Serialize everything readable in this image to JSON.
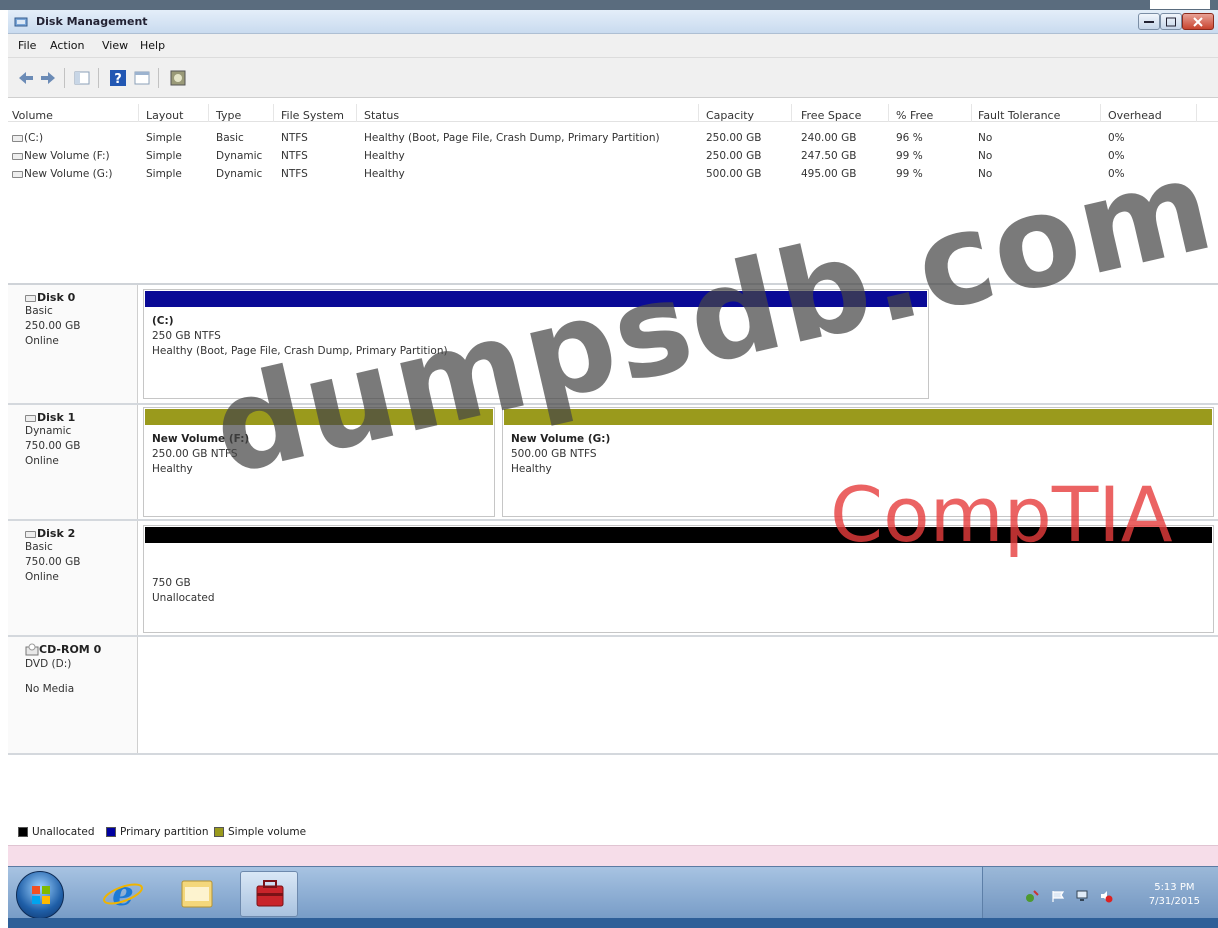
{
  "window": {
    "title": "Disk Management"
  },
  "menu": [
    "File",
    "Action",
    "View",
    "Help"
  ],
  "toolbar": {
    "icons": [
      "back-arrow-icon",
      "forward-arrow-icon",
      "console-tree-icon",
      "help-icon",
      "properties-icon",
      "disk-management-icon"
    ]
  },
  "volume_list": {
    "columns": [
      "Volume",
      "Layout",
      "Type",
      "File System",
      "Status",
      "Capacity",
      "Free Space",
      "% Free",
      "Fault Tolerance",
      "Overhead"
    ],
    "rows": [
      [
        "(C:)",
        "Simple",
        "Basic",
        "NTFS",
        "Healthy (Boot, Page File, Crash Dump, Primary Partition)",
        "250.00 GB",
        "240.00 GB",
        "96 %",
        "No",
        "0%"
      ],
      [
        "New Volume (F:)",
        "Simple",
        "Dynamic",
        "NTFS",
        "Healthy",
        "250.00 GB",
        "247.50 GB",
        "99 %",
        "No",
        "0%"
      ],
      [
        "New Volume (G:)",
        "Simple",
        "Dynamic",
        "NTFS",
        "Healthy",
        "500.00 GB",
        "495.00 GB",
        "99 %",
        "No",
        "0%"
      ]
    ]
  },
  "disks": [
    {
      "name": "Disk 0",
      "type": "Basic",
      "size": "250.00 GB",
      "state": "Online",
      "partitions": [
        {
          "name": "(C:)",
          "line1": "250 GB NTFS",
          "line2": "Healthy (Boot, Page File, Crash Dump, Primary Partition)",
          "kind": "Primary partition"
        }
      ]
    },
    {
      "name": "Disk 1",
      "type": "Dynamic",
      "size": "750.00 GB",
      "state": "Online",
      "partitions": [
        {
          "name": "New Volume (F:)",
          "line1": "250.00 GB NTFS",
          "line2": "Healthy",
          "kind": "Simple volume"
        },
        {
          "name": "New Volume (G:)",
          "line1": "500.00 GB NTFS",
          "line2": "Healthy",
          "kind": "Simple volume"
        }
      ]
    },
    {
      "name": "Disk 2",
      "type": "Basic",
      "size": "750.00 GB",
      "state": "Online",
      "partitions": [
        {
          "name": "",
          "line1": "750 GB",
          "line2": "Unallocated",
          "kind": "Unallocated"
        }
      ]
    },
    {
      "name": "CD-ROM 0",
      "type": "DVD (D:)",
      "size": "",
      "state": "No Media",
      "partitions": []
    }
  ],
  "legend": [
    {
      "label": "Unallocated",
      "color": "#000000"
    },
    {
      "label": "Primary partition",
      "color": "#0000a0"
    },
    {
      "label": "Simple volume",
      "color": "#9a9a1c"
    }
  ],
  "colors": {
    "primary_partition": "#0a0a96",
    "simple_volume": "#9a9a1c",
    "unallocated": "#000000"
  },
  "taskbar": {
    "pinned": [
      "start-orb-icon",
      "internet-explorer-icon",
      "windows-explorer-icon",
      "server-manager-icon"
    ],
    "clock_time": "5:13 PM",
    "clock_date": "7/31/2015"
  },
  "watermarks": [
    "dumpsdb.com",
    "CompTIA"
  ]
}
